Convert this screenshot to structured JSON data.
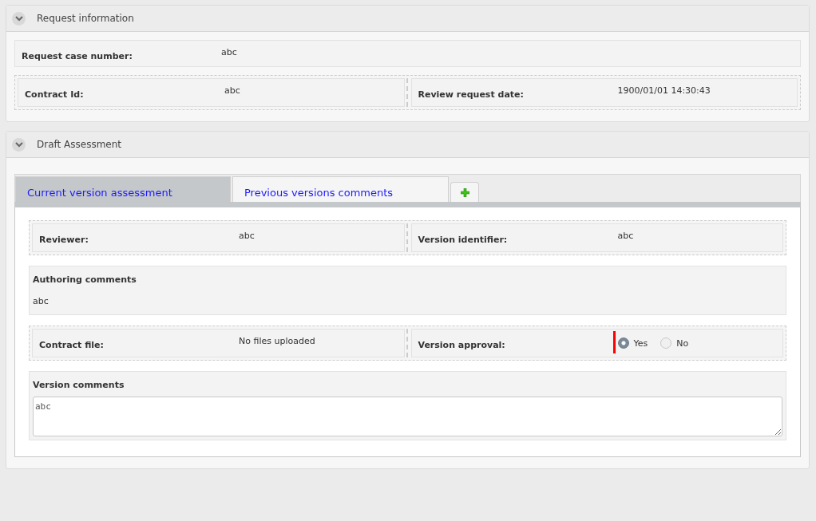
{
  "sections": [
    {
      "title": "Request information",
      "expanded": true,
      "rows": [
        {
          "kind": "single",
          "fields": [
            {
              "kind": "text",
              "label": "Request case number:",
              "value": "abc"
            }
          ]
        },
        {
          "kind": "pair",
          "fields": [
            {
              "kind": "text",
              "label": "Contract Id:",
              "value": "abc"
            },
            {
              "kind": "text",
              "label": "Review request date:",
              "value": "1900/01/01 14:30:43"
            }
          ]
        }
      ]
    },
    {
      "title": "Draft Assessment",
      "expanded": true,
      "tabs": [
        {
          "label": "Current version assessment",
          "selected": true
        },
        {
          "label": "Previous versions comments",
          "selected": false
        }
      ],
      "rows": [
        {
          "kind": "pair",
          "fields": [
            {
              "kind": "text",
              "label": "Reviewer:",
              "value": "abc"
            },
            {
              "kind": "text",
              "label": "Version identifier:",
              "value": "abc"
            }
          ]
        },
        {
          "kind": "note",
          "label": "Authoring comments",
          "text": "abc"
        },
        {
          "kind": "pair",
          "fields": [
            {
              "kind": "text",
              "label": "Contract file:",
              "value": "No files uploaded"
            },
            {
              "kind": "radio",
              "label": "Version approval:",
              "flagged": true,
              "options": [
                {
                  "label": "Yes",
                  "selected": true
                },
                {
                  "label": "No",
                  "selected": false
                }
              ]
            }
          ]
        },
        {
          "kind": "textarea",
          "label": "Version comments",
          "value": "abc"
        }
      ]
    }
  ]
}
